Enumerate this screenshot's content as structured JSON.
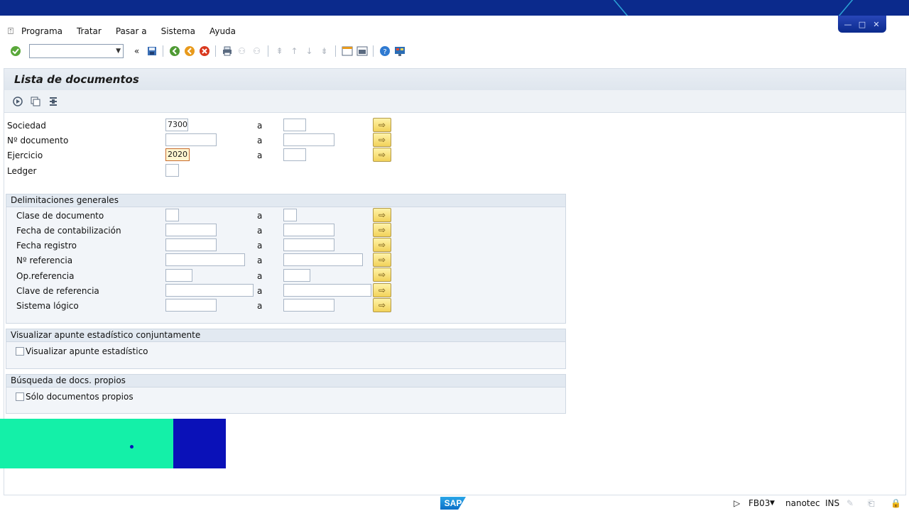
{
  "window": {
    "buttons": [
      "—",
      "□",
      "✕"
    ]
  },
  "menu": {
    "items": [
      "Programa",
      "Tratar",
      "Pasar a",
      "Sistema",
      "Ayuda"
    ]
  },
  "toolbar": {
    "command_value": ""
  },
  "screen": {
    "title": "Lista de documentos"
  },
  "fields": [
    {
      "label": "Sociedad",
      "from": "7300",
      "to": ""
    },
    {
      "label": "Nº documento",
      "from": "",
      "to": ""
    },
    {
      "label": "Ejercicio",
      "from": "2020",
      "to": ""
    },
    {
      "label": "Ledger",
      "from": ""
    }
  ],
  "range_separator": "a",
  "groups": {
    "general": {
      "title": "Delimitaciones generales",
      "fields": [
        {
          "label": "Clase de documento",
          "from": "",
          "to": ""
        },
        {
          "label": "Fecha de contabilización",
          "from": "",
          "to": ""
        },
        {
          "label": "Fecha registro",
          "from": "",
          "to": ""
        },
        {
          "label": "Nº referencia",
          "from": "",
          "to": ""
        },
        {
          "label": "Op.referencia",
          "from": "",
          "to": ""
        },
        {
          "label": "Clave de referencia",
          "from": "",
          "to": ""
        },
        {
          "label": "Sistema lógico",
          "from": "",
          "to": ""
        }
      ]
    },
    "statistical": {
      "title": "Visualizar apunte estadístico conjuntamente",
      "checkbox_label": "Visualizar apunte estadístico",
      "checked": false
    },
    "own_docs": {
      "title": "Búsqueda de docs. propios",
      "checkbox_label": "Sólo documentos propios",
      "checked": false
    }
  },
  "status": {
    "logo": "SAP",
    "transaction": "FB03",
    "user": "nanotec",
    "mode": "INS"
  },
  "colors": {
    "title_bar": "#0b2a8c",
    "overlay_green": "#14f0a8",
    "overlay_blue": "#0a11b8"
  }
}
